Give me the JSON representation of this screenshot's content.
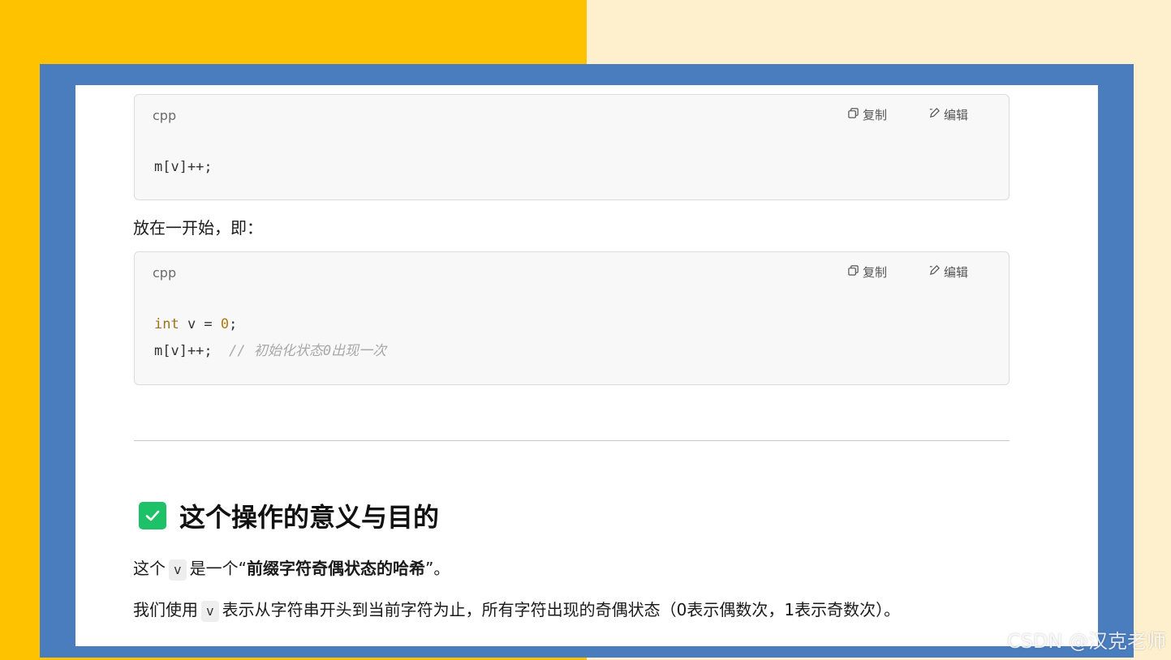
{
  "code_blocks": [
    {
      "lang": "cpp",
      "copy_label": "复制",
      "edit_label": "编辑",
      "lines": [
        "m[v]++;"
      ]
    },
    {
      "lang": "cpp",
      "copy_label": "复制",
      "edit_label": "编辑",
      "line1": {
        "kw": "int",
        "rest": " v = ",
        "num": "0",
        "end": ";"
      },
      "line2": {
        "code": "m[v]++;  ",
        "comment": "// 初始化状态0出现一次"
      }
    }
  ],
  "paragraph_intro": "放在一开始，即：",
  "heading": "这个操作的意义与目的",
  "para1": {
    "before": "这个",
    "code": "v",
    "middle": "是一个“",
    "bold": "前缀字符奇偶状态的哈希",
    "after": "”。"
  },
  "para2": {
    "before": "我们使用",
    "code": "v",
    "after": "表示从字符串开头到当前字符为止，所有字符出现的奇偶状态（0表示偶数次，1表示奇数次）。"
  },
  "watermark": "CSDN @汉克老师",
  "colors": {
    "left_bg": "#FFC200",
    "right_bg": "#FEF0CC",
    "frame": "#4A7DBE",
    "check": "#1DC167"
  }
}
